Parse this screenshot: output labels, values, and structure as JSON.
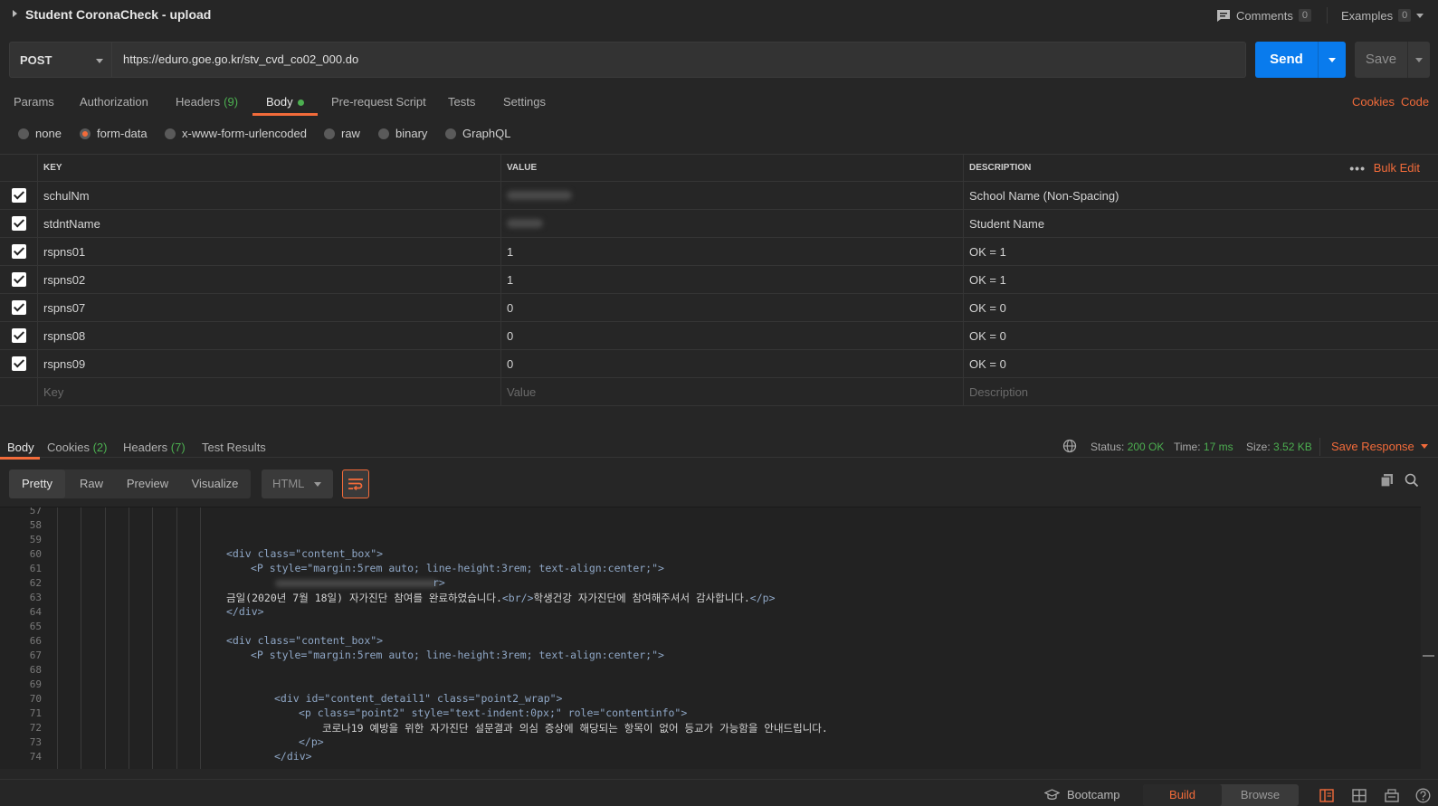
{
  "window": {
    "title": "Student CoronaCheck - upload"
  },
  "header": {
    "comments_label": "Comments",
    "comments_count": "0",
    "examples_label": "Examples",
    "examples_count": "0"
  },
  "request": {
    "method": "POST",
    "url": "https://eduro.goe.go.kr/stv_cvd_co02_000.do",
    "send_label": "Send",
    "save_label": "Save"
  },
  "req_tabs": [
    {
      "label": "Params"
    },
    {
      "label": "Authorization"
    },
    {
      "label": "Headers",
      "count": "(9)"
    },
    {
      "label": "Body"
    },
    {
      "label": "Pre-request Script"
    },
    {
      "label": "Tests"
    },
    {
      "label": "Settings"
    }
  ],
  "req_links": {
    "cookies": "Cookies",
    "code": "Code"
  },
  "body_types": [
    "none",
    "form-data",
    "x-www-form-urlencoded",
    "raw",
    "binary",
    "GraphQL"
  ],
  "selected_body_type": "form-data",
  "table": {
    "headers": {
      "key": "KEY",
      "value": "VALUE",
      "description": "DESCRIPTION",
      "bulk_edit": "Bulk Edit",
      "more": "•••"
    },
    "rows": [
      {
        "key": "schulNm",
        "value": "",
        "description": "School Name (Non-Spacing)"
      },
      {
        "key": "stdntName",
        "value": "",
        "description": "Student Name"
      },
      {
        "key": "rspns01",
        "value": "1",
        "description": "OK = 1"
      },
      {
        "key": "rspns02",
        "value": "1",
        "description": "OK = 1"
      },
      {
        "key": "rspns07",
        "value": "0",
        "description": "OK = 0"
      },
      {
        "key": "rspns08",
        "value": "0",
        "description": "OK = 0"
      },
      {
        "key": "rspns09",
        "value": "0",
        "description": "OK = 0"
      }
    ],
    "placeholders": {
      "key": "Key",
      "value": "Value",
      "description": "Description"
    }
  },
  "response": {
    "tabs": [
      {
        "label": "Body"
      },
      {
        "label": "Cookies",
        "count": "(2)"
      },
      {
        "label": "Headers",
        "count": "(7)"
      },
      {
        "label": "Test Results"
      }
    ],
    "status_label": "Status:",
    "status_value": "200 OK",
    "time_label": "Time:",
    "time_value": "17 ms",
    "size_label": "Size:",
    "size_value": "3.52 KB",
    "save_response": "Save Response",
    "views": [
      "Pretty",
      "Raw",
      "Preview",
      "Visualize"
    ],
    "format": "HTML"
  },
  "code": {
    "line_numbers": [
      "57",
      "58",
      "59",
      "60",
      "61",
      "62",
      "63",
      "64",
      "65",
      "66",
      "67",
      "68",
      "69",
      "70",
      "71",
      "72",
      "73",
      "74"
    ],
    "lines": {
      "l60": "<div class=\"content_box\">",
      "l61": "<P style=\"margin:5rem auto; line-height:3rem; text-align:center;\">",
      "l62": "r>",
      "l63a": "금일(2020년 7월 18일) 자가진단 참여를 완료하였습니다.",
      "l63b": "<br/>",
      "l63c": "학생건강 자가진단에 참여해주셔서 감사합니다.",
      "l63d": "</p>",
      "l64": "</div>",
      "l66": "<div class=\"content_box\">",
      "l67": "<P style=\"margin:5rem auto; line-height:3rem; text-align:center;\">",
      "l70": "<div id=\"content_detail1\" class=\"point2_wrap\">",
      "l71": "<p class=\"point2\" style=\"text-indent:0px;\" role=\"contentinfo\">",
      "l72": "코로나19 예방을 위한 자가진단 설문결과 의심 증상에 해당되는 항목이 없어 등교가 가능함을 안내드립니다.",
      "l73": "</p>",
      "l74": "</div>"
    }
  },
  "footer": {
    "bootcamp": "Bootcamp",
    "build": "Build",
    "browse": "Browse"
  },
  "colors": {
    "accent": "#f26b3a",
    "primary": "#097bed",
    "success": "#4caf50"
  }
}
